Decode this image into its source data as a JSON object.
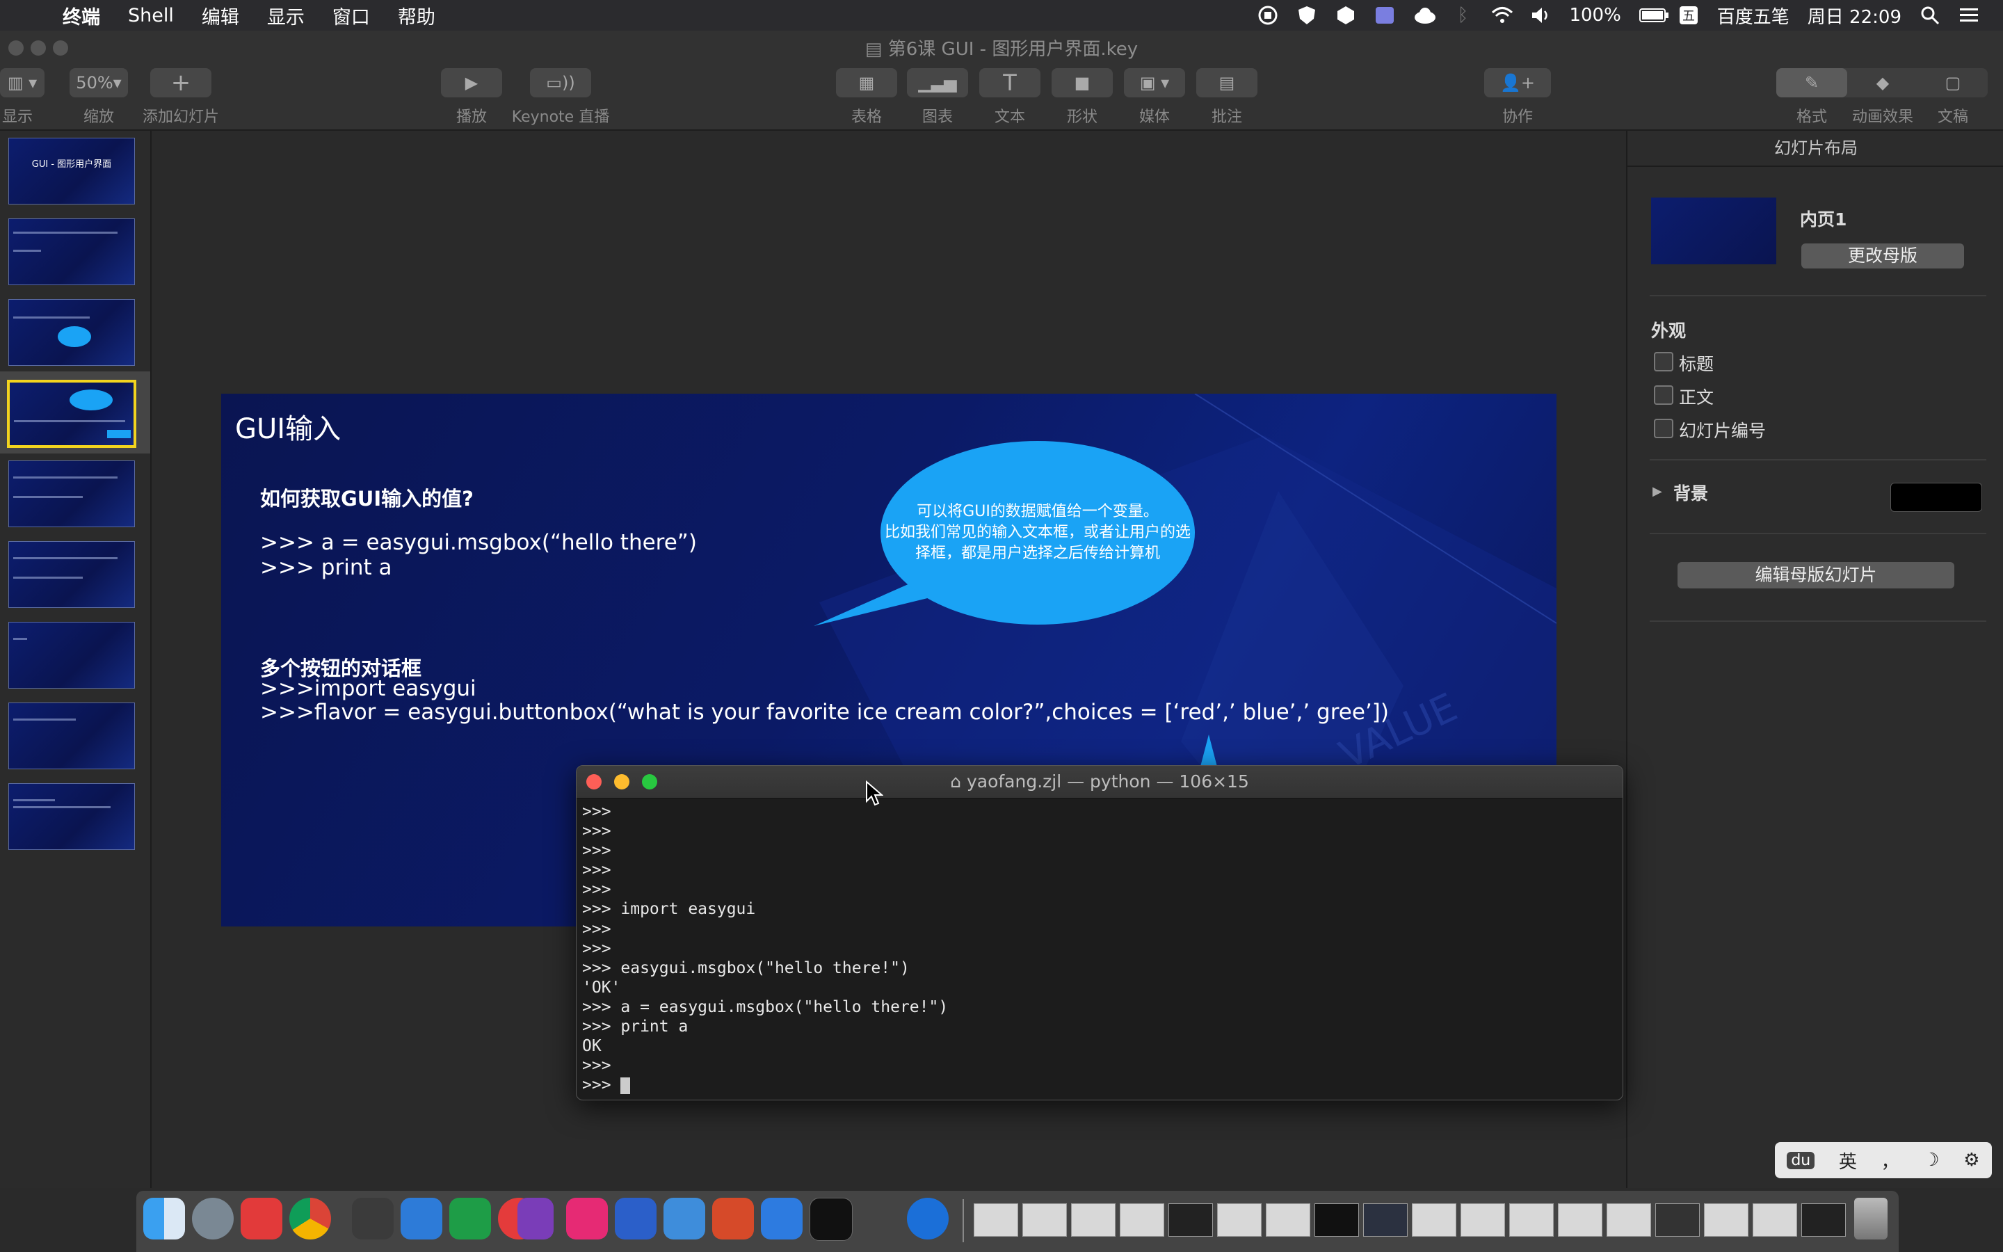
{
  "menubar": {
    "items": [
      "终端",
      "Shell",
      "编辑",
      "显示",
      "窗口",
      "帮助"
    ],
    "battery": "100%",
    "ime_name": "百度五笔",
    "clock": "周日 22:09"
  },
  "window": {
    "title": "第6课 GUI - 图形用户界面.key"
  },
  "toolbar": {
    "view_label": "显示",
    "zoom_value": "50%",
    "zoom_label": "缩放",
    "add_slide_label": "添加幻灯片",
    "play_label": "播放",
    "keynote_live_label": "Keynote 直播",
    "table_label": "表格",
    "chart_label": "图表",
    "text_label": "文本",
    "shape_label": "形状",
    "media_label": "媒体",
    "comment_label": "批注",
    "collaborate_label": "协作",
    "format_label": "格式",
    "animate_label": "动画效果",
    "document_label": "文稿"
  },
  "navigator": {
    "first_thumb_title": "GUI - 图形用户界面"
  },
  "slide": {
    "title": "GUI输入",
    "q1": "如何获取GUI输入的值?",
    "code1": ">>> a = easygui.msgbox(“hello there”)",
    "code2": ">>> print a",
    "q2": "多个按钮的对话框",
    "code3": ">>>import easygui",
    "code4": ">>>flavor = easygui.buttonbox(“what is your favorite ice cream color?”,choices = [‘red’,’ blue’,’ gree’])",
    "bubble_line1": "可以将GUI的数据赋值给一个变量。",
    "bubble_line2": "比如我们常见的输入文本框，或者让用户的选",
    "bubble_line3": "择框，都是用户选择之后传给计算机"
  },
  "inspector": {
    "header": "幻灯片布局",
    "master_name": "内页1",
    "change_master_button": "更改母版",
    "appearance_label": "外观",
    "checkbox_title": "标题",
    "checkbox_body": "正文",
    "checkbox_slide_number": "幻灯片编号",
    "background_label": "背景",
    "background_color": "#000000",
    "edit_master_button": "编辑母版幻灯片"
  },
  "terminal": {
    "title": "yaofang.zjl — python — 106×15",
    "lines": [
      ">>>",
      ">>>",
      ">>>",
      ">>>",
      ">>>",
      ">>> import easygui",
      ">>>",
      ">>>",
      ">>> easygui.msgbox(\"hello there!\")",
      "'OK'",
      ">>> a = easygui.msgbox(\"hello there!\")",
      ">>> print a",
      "OK",
      ">>>",
      ">>> "
    ]
  },
  "ime": {
    "logo": "du",
    "lang": "英",
    "punct": "，",
    "moon": "☽",
    "gear": "⚙"
  },
  "colors": {
    "bubble": "#1aa3f5",
    "selected_thumb_border": "#f3d41e",
    "slide_bg": "#0b1a66"
  }
}
